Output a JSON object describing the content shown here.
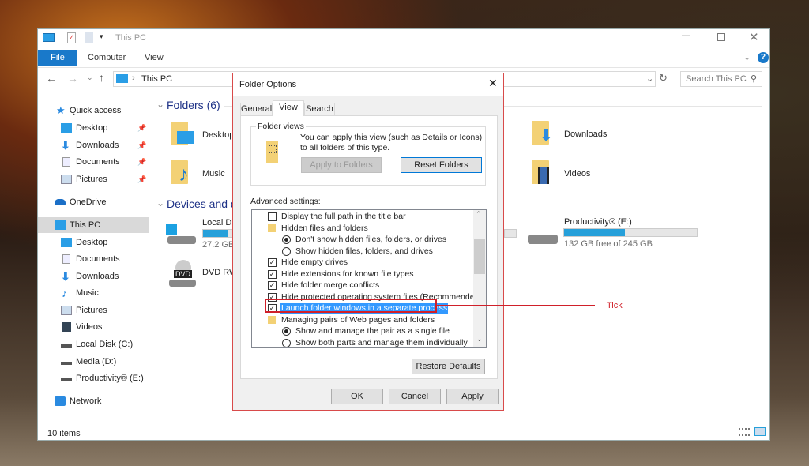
{
  "explorer": {
    "title": "This PC",
    "ribbon_tabs": [
      "File",
      "Computer",
      "View"
    ],
    "address": "This PC",
    "search_placeholder": "Search This PC",
    "status": "10 items",
    "sidebar": {
      "quick_access": "Quick access",
      "quick_items": [
        "Desktop",
        "Downloads",
        "Documents",
        "Pictures"
      ],
      "onedrive": "OneDrive",
      "this_pc": "This PC",
      "pc_items": [
        "Desktop",
        "Documents",
        "Downloads",
        "Music",
        "Pictures",
        "Videos",
        "Local Disk (C:)",
        "Media (D:)",
        "Productivity® (E:)"
      ],
      "network": "Network"
    },
    "folders_header": "Folders (6)",
    "folders": [
      "Desktop",
      "Music",
      "Downloads",
      "Videos"
    ],
    "devices_header": "Devices and d",
    "drives": [
      {
        "name": "Local Di",
        "free": "27.2 GB f",
        "used_pct": 85
      },
      {
        "name": "DVD RW"
      },
      {
        "name": "Productivity® (E:)",
        "free": "132 GB free of 245 GB",
        "used_pct": 46
      }
    ]
  },
  "dialog": {
    "title": "Folder Options",
    "tabs": [
      "General",
      "View",
      "Search"
    ],
    "active_tab": "View",
    "folder_views_label": "Folder views",
    "folder_views_text": "You can apply this view (such as Details or Icons) to all folders of this type.",
    "apply_to_folders": "Apply to Folders",
    "reset_folders": "Reset Folders",
    "advanced_label": "Advanced settings:",
    "settings": [
      {
        "type": "checkbox",
        "label": "Display the full path in the title bar",
        "checked": false
      },
      {
        "type": "folder",
        "label": "Hidden files and folders"
      },
      {
        "type": "radio",
        "label": "Don't show hidden files, folders, or drives",
        "checked": true
      },
      {
        "type": "radio",
        "label": "Show hidden files, folders, and drives",
        "checked": false
      },
      {
        "type": "checkbox",
        "label": "Hide empty drives",
        "checked": true
      },
      {
        "type": "checkbox",
        "label": "Hide extensions for known file types",
        "checked": true
      },
      {
        "type": "checkbox",
        "label": "Hide folder merge conflicts",
        "checked": true
      },
      {
        "type": "checkbox",
        "label": "Hide protected operating system files (Recommended)",
        "checked": true
      },
      {
        "type": "checkbox",
        "label": "Launch folder windows in a separate process",
        "checked": true,
        "highlighted": true
      },
      {
        "type": "folder",
        "label": "Managing pairs of Web pages and folders"
      },
      {
        "type": "radio",
        "label": "Show and manage the pair as a single file",
        "checked": true
      },
      {
        "type": "radio",
        "label": "Show both parts and manage them individually",
        "checked": false
      }
    ],
    "restore_defaults": "Restore Defaults",
    "ok": "OK",
    "cancel": "Cancel",
    "apply": "Apply"
  },
  "annotation": {
    "label": "Tick",
    "color": "#d0202a"
  },
  "colors": {
    "accent": "#1979ca",
    "selection": "#3399ff",
    "drive_bar": "#26a0da"
  }
}
